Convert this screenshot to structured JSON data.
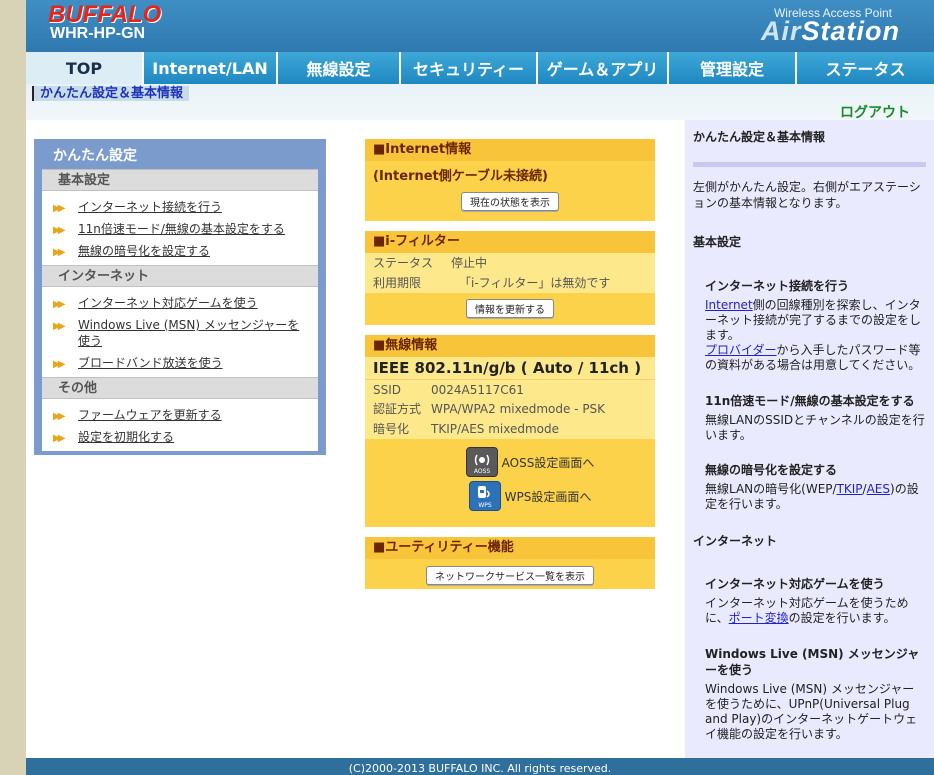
{
  "header": {
    "brand": "BUFFALO",
    "model": "WHR-HP-GN",
    "product_line": "Wireless Access Point",
    "logo_text_a": "Air",
    "logo_text_b": "Station"
  },
  "nav": {
    "tabs": [
      {
        "label": "TOP"
      },
      {
        "label": "Internet/LAN"
      },
      {
        "label": "無線設定"
      },
      {
        "label": "セキュリティー"
      },
      {
        "label": "ゲーム＆アプリ"
      },
      {
        "label": "管理設定"
      },
      {
        "label": "ステータス"
      }
    ]
  },
  "breadcrumb": "かんたん設定＆基本情報",
  "logout_label": "ログアウト",
  "left_panel": {
    "title": "かんたん設定",
    "sections": [
      {
        "label": "基本設定",
        "items": [
          "インターネット接続を行う",
          "11n倍速モード/無線の基本設定をする",
          "無線の暗号化を設定する"
        ]
      },
      {
        "label": "インターネット",
        "items": [
          "インターネット対応ゲームを使う",
          "Windows Live (MSN) メッセンジャーを使う",
          "ブロードバンド放送を使う"
        ]
      },
      {
        "label": "その他",
        "items": [
          "ファームウェアを更新する",
          "設定を初期化する"
        ]
      }
    ]
  },
  "internet_box": {
    "title": "■Internet情報",
    "status": "(Internet側ケーブル未接続)",
    "button": "現在の状態を表示"
  },
  "filter_box": {
    "title": "■i-フィルター",
    "rows": [
      {
        "key": "ステータス",
        "value": "停止中"
      },
      {
        "key": "利用期限",
        "value": "「i-フィルター」は無効です"
      }
    ],
    "button": "情報を更新する"
  },
  "wireless_box": {
    "title": "■無線情報",
    "standard": "IEEE 802.11n/g/b ( Auto / 11ch )",
    "rows": [
      {
        "key": "SSID",
        "value": "0024A5117C61"
      },
      {
        "key": "認証方式",
        "value": "WPA/WPA2 mixedmode - PSK"
      },
      {
        "key": "暗号化",
        "value": "TKIP/AES mixedmode"
      }
    ],
    "aoss_label": "AOSS設定画面へ",
    "aoss_icon_text": "AOSS",
    "wps_label": "WPS設定画面へ",
    "wps_icon_text": "WPS"
  },
  "utility_box": {
    "title": "■ユーティリティー機能",
    "button": "ネットワークサービス一覧を表示"
  },
  "help": {
    "title": "かんたん設定＆基本情報",
    "intro": "左側がかんたん設定。右側がエアステーションの基本情報となります。",
    "basic_heading": "基本設定",
    "internet_conn_heading": "インターネット接続を行う",
    "internet_conn_link1": "Internet",
    "internet_conn_text1": "側の回線種別を探索し、インターネット接続が完了するまでの設定をします。",
    "internet_conn_link2": "プロバイダー",
    "internet_conn_text2": "から入手したパスワード等の資料がある場合は用意してください。",
    "n11_heading": "11n倍速モード/無線の基本設定をする",
    "n11_text": "無線LANのSSIDとチャンネルの設定を行います。",
    "encrypt_heading": "無線の暗号化を設定する",
    "encrypt_text_a": "無線LANの暗号化(WEP/",
    "encrypt_link_tkip": "TKIP",
    "encrypt_slash": "/",
    "encrypt_link_aes": "AES",
    "encrypt_text_b": ")の設定を行います。",
    "internet_heading": "インターネット",
    "game_heading": "インターネット対応ゲームを使う",
    "game_text_a": "インターネット対応ゲームを使うために、",
    "game_link": "ポート変換",
    "game_text_b": "の設定を行います。",
    "msn_heading": "Windows Live (MSN) メッセンジャーを使う",
    "msn_text": "Windows Live (MSN) メッセンジャーを使うために、UPnP(Universal Plug and Play)のインターネットゲートウェイ機能の設定を行います。"
  },
  "footer": "(C)2000-2013 BUFFALO INC. All rights reserved."
}
